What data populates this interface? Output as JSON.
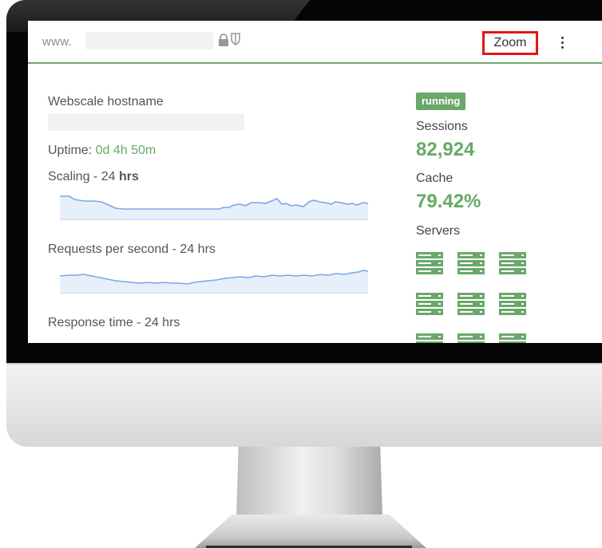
{
  "browser": {
    "url_prefix": "www.",
    "zoom_label": "Zoom"
  },
  "dashboard": {
    "hostname_label": "Webscale hostname",
    "uptime_label": "Uptime:",
    "uptime_value": "0d 4h 50m",
    "scaling": {
      "title_prefix": "Scaling - 24 ",
      "title_suffix": "hrs"
    },
    "requests": {
      "title": "Requests per second - 24 hrs"
    },
    "response": {
      "title": "Response time - 24 hrs"
    },
    "status": "running",
    "sessions_label": "Sessions",
    "sessions_value": "82,924",
    "cache_label": "Cache",
    "cache_value": "79.42%",
    "servers_label": "Servers",
    "server_count_visible": 9
  },
  "colors": {
    "accent_green": "#6aa86a",
    "sparkline_blue": "#7aa7e6",
    "highlight_red": "#e01818"
  },
  "icons": [
    "lock-icon",
    "shield-icon",
    "more-vert-icon",
    "server-icon"
  ]
}
